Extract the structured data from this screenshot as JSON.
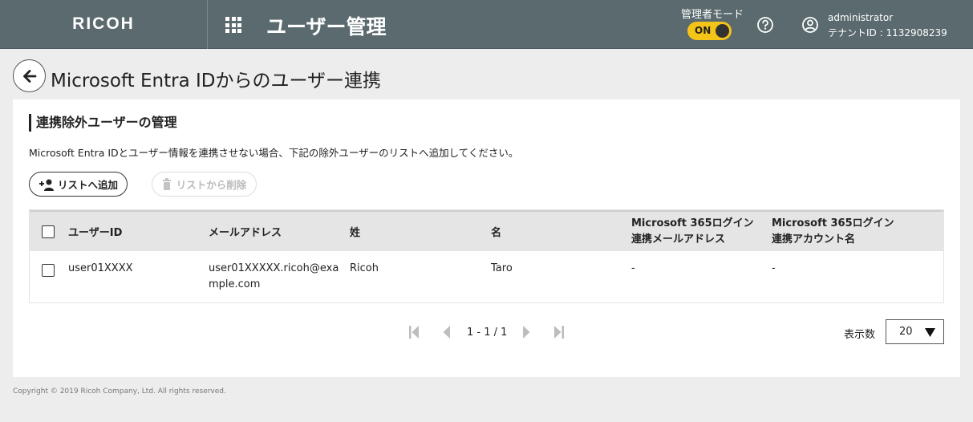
{
  "header": {
    "logo": "RICOH",
    "app_title": "ユーザー管理",
    "admin_mode_label": "管理者モード",
    "toggle_label": "ON",
    "user_name": "administrator",
    "tenant_label": "テナントID : 1132908239",
    "icons": [
      "apps-grid-icon",
      "help-icon",
      "user-account-icon"
    ]
  },
  "page": {
    "title": "Microsoft Entra IDからのユーザー連携"
  },
  "section": {
    "title": "連携除外ユーザーの管理",
    "description": "Microsoft Entra IDとユーザー情報を連携させない場合、下記の除外ユーザーのリストへ追加してください。",
    "add_button": "リストへ追加",
    "delete_button": "リストから削除"
  },
  "table": {
    "headers": {
      "user_id": "ユーザーID",
      "email": "メールアドレス",
      "last_name": "姓",
      "first_name": "名",
      "ms365_email_line1": "Microsoft 365ログイン",
      "ms365_email_line2": "連携メールアドレス",
      "ms365_account_line1": "Microsoft 365ログイン",
      "ms365_account_line2": "連携アカウント名"
    },
    "rows": [
      {
        "user_id": "user01XXXX",
        "email_line1": "user01XXXXX.ricoh@exa",
        "email_line2": "mple.com",
        "last_name": "Ricoh",
        "first_name": "Taro",
        "ms365_email": "-",
        "ms365_account": "-"
      }
    ]
  },
  "pagination": {
    "info": "1 - 1 / 1",
    "per_page_label": "表示数",
    "per_page_value": "20"
  },
  "footer": {
    "copyright": "Copyright © 2019 Ricoh Company, Ltd. All rights reserved."
  },
  "colors": {
    "header_bg": "#5a6a6e",
    "toggle_bg": "#f4c418",
    "page_bg": "#ededed"
  }
}
